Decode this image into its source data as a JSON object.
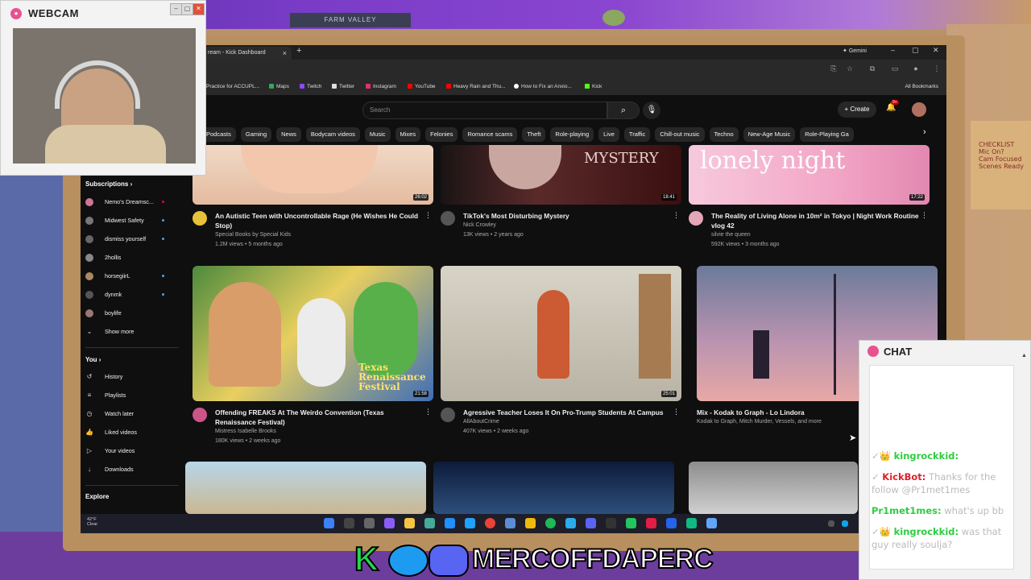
{
  "scene": {
    "top_sign": "FARM VALLEY",
    "board_text": [
      "CHECKLIST",
      "Mic On?",
      "Cam Focused",
      "Scenes Ready"
    ]
  },
  "browser": {
    "tab_title": "ream - Kick Dashboard",
    "gemini_label": "Gemini",
    "bookmarks": [
      "Practice for ACCUPL...",
      "Maps",
      "Twitch",
      "Twitter",
      "Instagram",
      "YouTube",
      "Heavy Rain and Thu...",
      "How to Fix an Anxio...",
      "Kick"
    ],
    "all_bookmarks": "All Bookmarks"
  },
  "youtube": {
    "search_placeholder": "Search",
    "create_label": "Create",
    "notification_count": "9+",
    "chips": [
      "Podcasts",
      "Gaming",
      "News",
      "Bodycam videos",
      "Music",
      "Mixes",
      "Felonies",
      "Romance scams",
      "Theft",
      "Role-playing",
      "Live",
      "Traffic",
      "Chill-out music",
      "Techno",
      "New-Age Music",
      "Role-Playing Ga"
    ],
    "sidebar": {
      "subscriptions_label": "Subscriptions",
      "subscriptions": [
        {
          "name": "Nemo's Dreamsc...",
          "live": true
        },
        {
          "name": "Midwest Safety",
          "live": true
        },
        {
          "name": "dismiss yourself",
          "live": true
        },
        {
          "name": "2hollis",
          "live": false
        },
        {
          "name": "horsegiirL",
          "live": true
        },
        {
          "name": "dynmk",
          "live": true
        },
        {
          "name": "boylife",
          "live": false
        }
      ],
      "show_more": "Show more",
      "you_label": "You",
      "you_items": [
        "History",
        "Playlists",
        "Watch later",
        "Liked videos",
        "Your videos",
        "Downloads"
      ],
      "explore_label": "Explore"
    },
    "videos": [
      {
        "title": "An Autistic Teen with Uncontrollable Rage (He Wishes He Could Stop)",
        "channel": "Special Books by Special Kids",
        "meta": "1.2M views • 5 months ago",
        "duration": "26:02",
        "overlay": ""
      },
      {
        "title": "TikTok's Most Disturbing Mystery",
        "channel": "Nick Crowley",
        "meta": "13K views • 2 years ago",
        "duration": "18:41",
        "overlay": "MYSTERY"
      },
      {
        "title": "The Reality of Living Alone in 10m² in Tokyo | Night Work Routine vlog 42",
        "channel": "silvie the queen",
        "meta": "592K views • 3 months ago",
        "duration": "17:22",
        "overlay": "lonely night"
      },
      {
        "title": "Offending FREAKS At The Weirdo Convention (Texas Renaissance Festival)",
        "channel": "Mistress Isabelle Brooks",
        "meta": "180K views • 2 weeks ago",
        "duration": "21:58",
        "overlay": "Texas Renaissance Festival"
      },
      {
        "title": "Agressive Teacher Loses It On Pro-Trump Students At Campus",
        "channel": "AllAboutCrime",
        "meta": "407K views • 2 weeks ago",
        "duration": "25:01",
        "overlay": ""
      },
      {
        "title": "Mix - Kodak to Graph - Lo Lindora",
        "channel": "Kodak to Graph, Mitch Murder, Vessels, and more",
        "meta": "",
        "duration": "",
        "overlay": ""
      }
    ]
  },
  "taskbar": {
    "temp": "42°F",
    "condition": "Clear"
  },
  "webcam": {
    "title": "WEBCAM"
  },
  "chat": {
    "title": "CHAT",
    "messages": [
      {
        "user": "kingrockkid:",
        "text": "",
        "user_color": "#2ecc40"
      },
      {
        "user": "KickBot:",
        "text": "Thanks for the follow @Pr1met1mes",
        "user_color": "#e0202a"
      },
      {
        "user": "Pr1met1mes:",
        "text": "what's up bb",
        "user_color": "#2ecc40"
      },
      {
        "user": "kingrockkid:",
        "text": "was that guy really soulja?",
        "user_color": "#2ecc40"
      }
    ]
  },
  "banner": {
    "text": "MERCOFFDAPERC"
  }
}
